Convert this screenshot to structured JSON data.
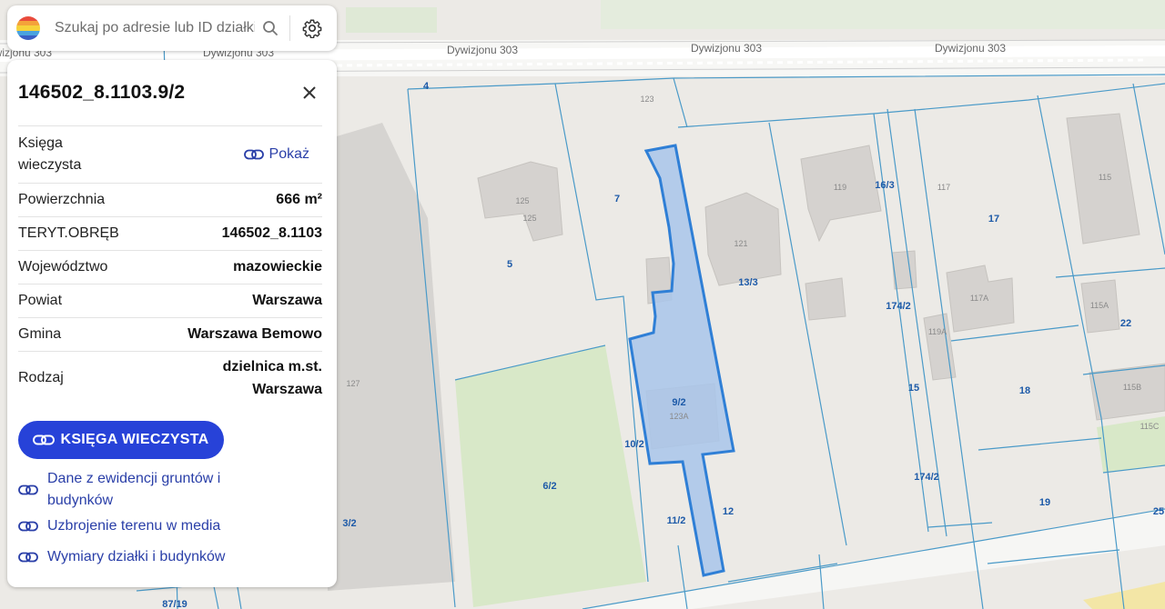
{
  "search": {
    "placeholder": "Szukaj po adresie lub ID działki"
  },
  "icons": {
    "search": "search-icon",
    "settings": "gear-icon",
    "close": "close-icon",
    "link": "link-icon"
  },
  "colors": {
    "accent": "#2742d8",
    "link": "#2a3fa8",
    "plot_border": "#4a90c8",
    "selected_fill": "#a9c6ea",
    "selected_border": "#2f7fd6",
    "green_area": "#d8e8c8"
  },
  "panel": {
    "title": "146502_8.1103.9/2",
    "rows": [
      {
        "label": "Księga wieczysta",
        "value": "Pokaż"
      },
      {
        "label": "Powierzchnia",
        "value": "666 m²"
      },
      {
        "label": "TERYT.OBRĘB",
        "value": "146502_8.1103"
      },
      {
        "label": "Województwo",
        "value": "mazowieckie"
      },
      {
        "label": "Powiat",
        "value": "Warszawa"
      },
      {
        "label": "Gmina",
        "value": "Warszawa Bemowo"
      },
      {
        "label": "Rodzaj",
        "value": "dzielnica m.st. Warszawa"
      }
    ],
    "button_label": "KSIĘGA WIECZYSTA",
    "links": [
      "Dane z ewidencji gruntów i budynków",
      "Uzbrojenie terenu w media",
      "Wymiary działki i budynków"
    ]
  },
  "map": {
    "streets": [
      "Dywizjonu 303",
      "Dywizjonu 303",
      "Dywizjonu 303",
      "Dywizjonu 303"
    ],
    "plot_labels": [
      "4",
      "7",
      "5",
      "6/2",
      "10/2",
      "11/2",
      "9/2",
      "12",
      "13/3",
      "16/3",
      "174/2",
      "15",
      "174/2",
      "17",
      "18",
      "19",
      "22",
      "25",
      "3/2",
      "87/19"
    ],
    "building_labels": [
      "123",
      "125",
      "125",
      "121",
      "119",
      "117",
      "115",
      "117A",
      "119A",
      "115A",
      "115B",
      "115C",
      "123A",
      "127"
    ]
  }
}
